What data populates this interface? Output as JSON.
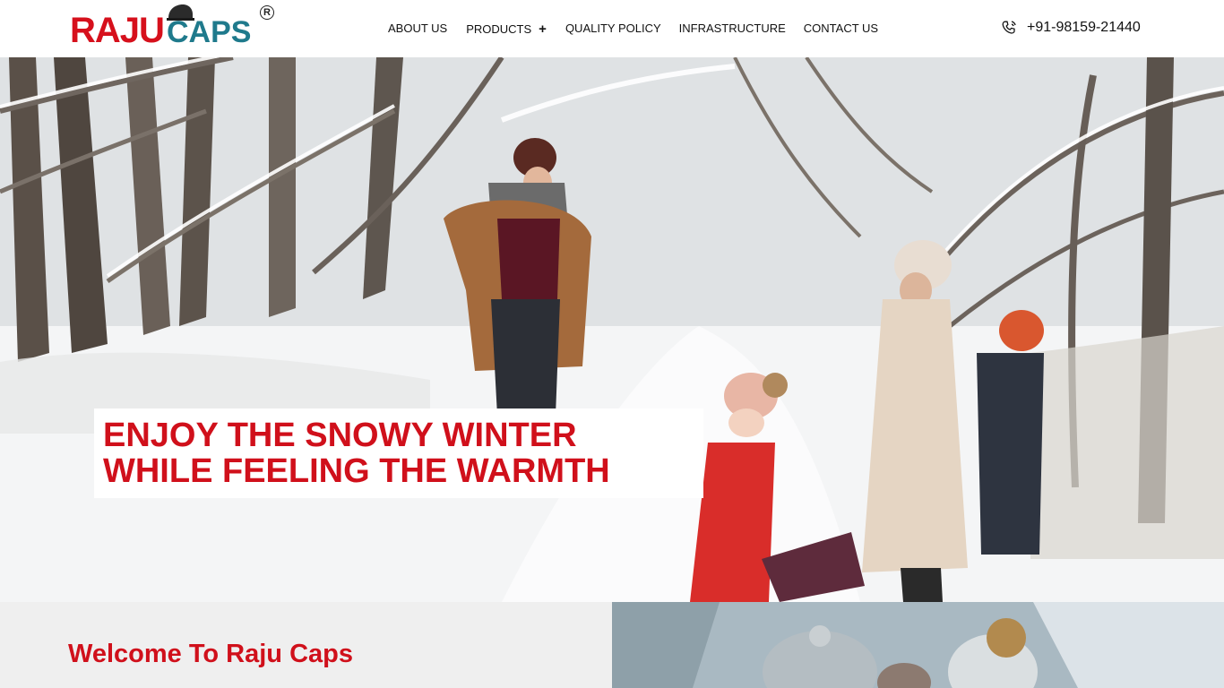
{
  "header": {
    "logo": {
      "part1": "RAJU",
      "part2": "CAPS",
      "registered": "R",
      "colors": {
        "primary": "#d6101c",
        "secondary": "#1f7a8c"
      }
    },
    "nav": [
      {
        "label": "ABOUT US"
      },
      {
        "label": "PRODUCTS",
        "expand_symbol": "+"
      },
      {
        "label": "QUALITY POLICY"
      },
      {
        "label": "INFRASTRUCTURE"
      },
      {
        "label": "CONTACT US"
      }
    ],
    "phone": {
      "icon": "phone-ringing-icon",
      "number": "+91-98159-21440"
    }
  },
  "hero": {
    "caption": "ENJOY THE SNOWY WINTER WHILE FEELING THE WARMTH",
    "image": "snowy forest family photo"
  },
  "welcome": {
    "title": "Welcome To Raju Caps"
  },
  "side_image": "kids in knitted beanies photo",
  "colors": {
    "accent": "#d0101b",
    "panel": "#efefef"
  }
}
